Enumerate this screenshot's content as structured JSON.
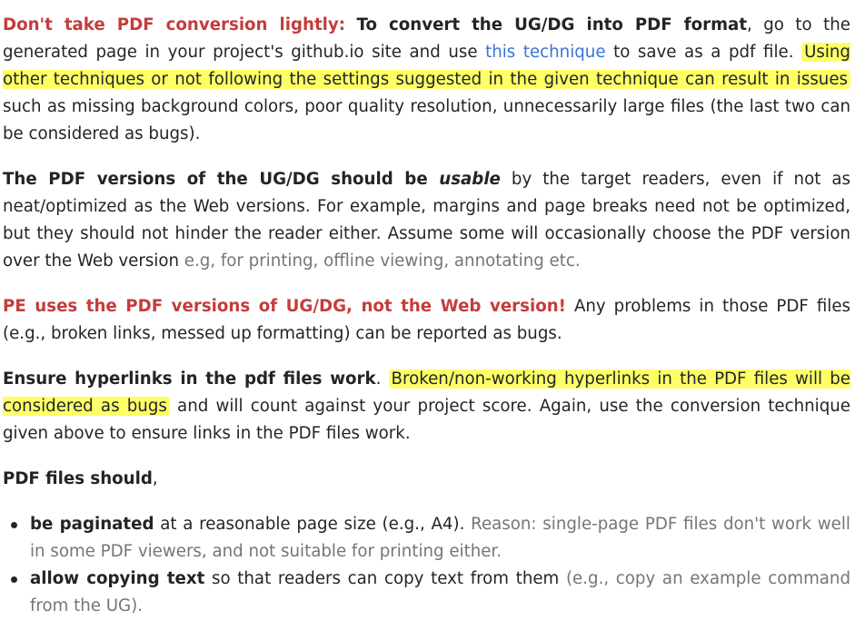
{
  "p1": {
    "lead": "Don't take PDF conversion lightly:",
    "bold": "To convert the UG/DG into PDF format",
    "text1": ", go to the generated page in your project's github.io site and use ",
    "link": "this technique",
    "text2": " to save as a pdf file. ",
    "highlight": "Using other techniques or not following the settings suggested in the given technique can result in issues",
    "text3": " such as missing background colors, poor quality resolution, unnecessarily large files (the last two can be considered as bugs)."
  },
  "p2": {
    "bold": "The PDF versions of the UG/DG should be ",
    "italic": "usable",
    "text": " by the target readers, even if not as neat/optimized as the Web versions. For example, margins and page breaks need not be optimized, but they should not hinder the reader either. Assume some will occasionally choose the PDF version over the Web version ",
    "muted": "e.g, for printing, offline viewing, annotating etc."
  },
  "p3": {
    "lead": "PE uses the PDF versions of UG/DG, not the Web version!",
    "text": " Any problems in those PDF files (e.g., broken links, messed up formatting) can be reported as bugs."
  },
  "p4": {
    "bold": "Ensure hyperlinks in the pdf files work",
    "text1": ". ",
    "highlight": "Broken/non-working hyperlinks in the PDF files will be considered as bugs",
    "text2": " and will count against your project score. Again, use the conversion technique given above to ensure links in the PDF files work."
  },
  "p5": {
    "bold": "PDF files should",
    "text": ","
  },
  "list": [
    {
      "bold": "be paginated",
      "text": " at a reasonable page size (e.g., A4). ",
      "muted": "Reason: single-page PDF files don't work well in some PDF viewers, and not suitable for printing either."
    },
    {
      "bold": "allow copying text",
      "text": " so that readers can copy text from them ",
      "muted": "(e.g., copy an example command from the UG)."
    }
  ]
}
